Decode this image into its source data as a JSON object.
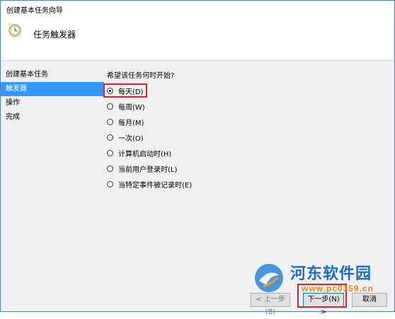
{
  "window": {
    "title": "创建基本任务向导"
  },
  "header": {
    "title": "任务触发器",
    "icon": "clock-wizard-icon"
  },
  "nav": {
    "items": [
      {
        "label": "创建基本任务",
        "selected": false
      },
      {
        "label": "触发器",
        "selected": true
      },
      {
        "label": "操作",
        "selected": false
      },
      {
        "label": "完成",
        "selected": false
      }
    ]
  },
  "trigger": {
    "question": "希望该任务何时开始?",
    "options": [
      {
        "label": "每天(D)",
        "checked": true
      },
      {
        "label": "每周(W)",
        "checked": false
      },
      {
        "label": "每月(M)",
        "checked": false
      },
      {
        "label": "一次(O)",
        "checked": false
      },
      {
        "label": "计算机启动时(H)",
        "checked": false
      },
      {
        "label": "当前用户登录时(L)",
        "checked": false
      },
      {
        "label": "当特定事件被记录时(E)",
        "checked": false
      }
    ]
  },
  "buttons": {
    "back": "< 上一步(B)",
    "next": "下一步(N) >",
    "cancel": "取消"
  },
  "watermark": {
    "title": "河东软件园",
    "url": "www.pc0359.cn"
  },
  "colors": {
    "selection": "#3399ff",
    "highlight": "#e0202a",
    "border": "#4f7ec2"
  }
}
